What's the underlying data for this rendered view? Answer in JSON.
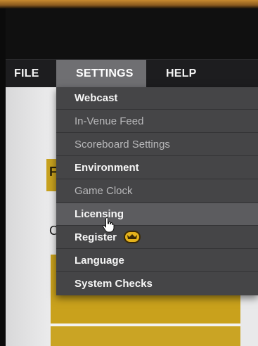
{
  "menubar": {
    "file_label": "FILE",
    "settings_label": "SETTINGS",
    "help_label": "HELP"
  },
  "settings_menu": {
    "items": [
      {
        "label": "Webcast",
        "enabled": true
      },
      {
        "label": "In-Venue Feed",
        "enabled": false
      },
      {
        "label": "Scoreboard Settings",
        "enabled": false
      },
      {
        "label": "Environment",
        "enabled": true
      },
      {
        "label": "Game Clock",
        "enabled": false
      },
      {
        "label": "Licensing",
        "enabled": true,
        "hovered": true
      },
      {
        "label": "Register",
        "enabled": true,
        "badge": "premium-badge-icon"
      },
      {
        "label": "Language",
        "enabled": true
      },
      {
        "label": "System Checks",
        "enabled": true
      }
    ]
  },
  "page": {
    "accent_letter": "F",
    "body_letter": "C"
  },
  "colors": {
    "menubar_bg": "#1d1d1f",
    "menu_active_bg": "#6f6f72",
    "dropdown_bg": "#454547",
    "accent_gold": "#c9a11c",
    "badge_gold": "#e5b21b"
  },
  "icons": {
    "cursor": "hand-pointer-icon",
    "badge": "premium-badge-icon"
  }
}
